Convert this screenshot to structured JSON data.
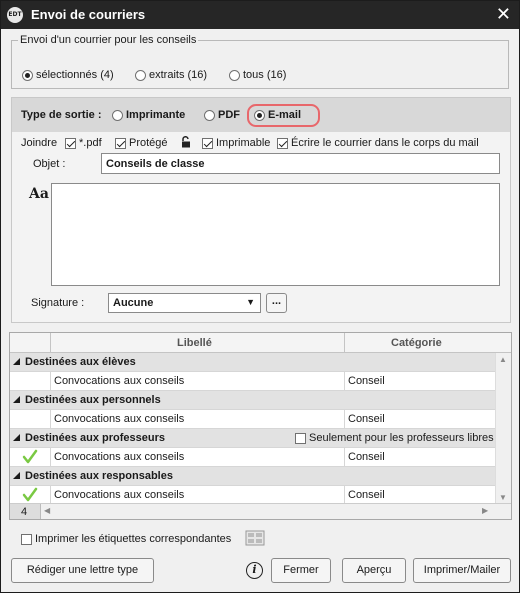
{
  "window": {
    "title": "Envoi de courriers",
    "app_icon": "EDT"
  },
  "group": {
    "legend": "Envoi d'un courrier pour les conseils",
    "options": [
      {
        "label": "sélectionnés (4)",
        "selected": true
      },
      {
        "label": "extraits (16)",
        "selected": false
      },
      {
        "label": "tous (16)",
        "selected": false
      }
    ]
  },
  "sortie": {
    "label": "Type de sortie :",
    "options": [
      {
        "label": "Imprimante",
        "selected": false
      },
      {
        "label": "PDF",
        "selected": false
      },
      {
        "label": "E-mail",
        "selected": true
      }
    ],
    "highlight_color": "#e8676b"
  },
  "joindre": {
    "label": "Joindre",
    "options": [
      {
        "label": "*.pdf",
        "checked": true
      },
      {
        "label": "Protégé",
        "checked": true
      },
      {
        "label": "Imprimable",
        "checked": true
      },
      {
        "label": "Écrire le courrier dans le corps du mail",
        "checked": true
      }
    ]
  },
  "objet": {
    "label": "Objet :",
    "value": "Conseils de classe"
  },
  "body_editor": {
    "font_icon_text": "Aa"
  },
  "signature": {
    "label": "Signature :",
    "value": "Aucune",
    "more": "..."
  },
  "table": {
    "columns": [
      "Libellé",
      "Catégorie"
    ],
    "groups": [
      {
        "title": "Destinées aux élèves",
        "row": {
          "label": "Convocations aux conseils",
          "category": "Conseil",
          "checked": false
        }
      },
      {
        "title": "Destinées aux personnels",
        "row": {
          "label": "Convocations aux conseils",
          "category": "Conseil",
          "checked": false
        }
      },
      {
        "title": "Destinées aux professeurs",
        "extra": "Seulement pour les professeurs libres",
        "row": {
          "label": "Convocations aux conseils",
          "category": "Conseil",
          "checked": true
        }
      },
      {
        "title": "Destinées aux responsables",
        "row": {
          "label": "Convocations aux conseils",
          "category": "Conseil",
          "checked": true
        }
      }
    ],
    "count": "4"
  },
  "etiquettes": {
    "label": "Imprimer les étiquettes correspondantes",
    "checked": false
  },
  "buttons": {
    "rediger": "Rédiger une lettre type",
    "info": "i",
    "fermer": "Fermer",
    "apercu": "Aperçu",
    "imprimer": "Imprimer/Mailer"
  },
  "colors": {
    "titlebar": "#262626",
    "checkmark": "#7ac943"
  }
}
